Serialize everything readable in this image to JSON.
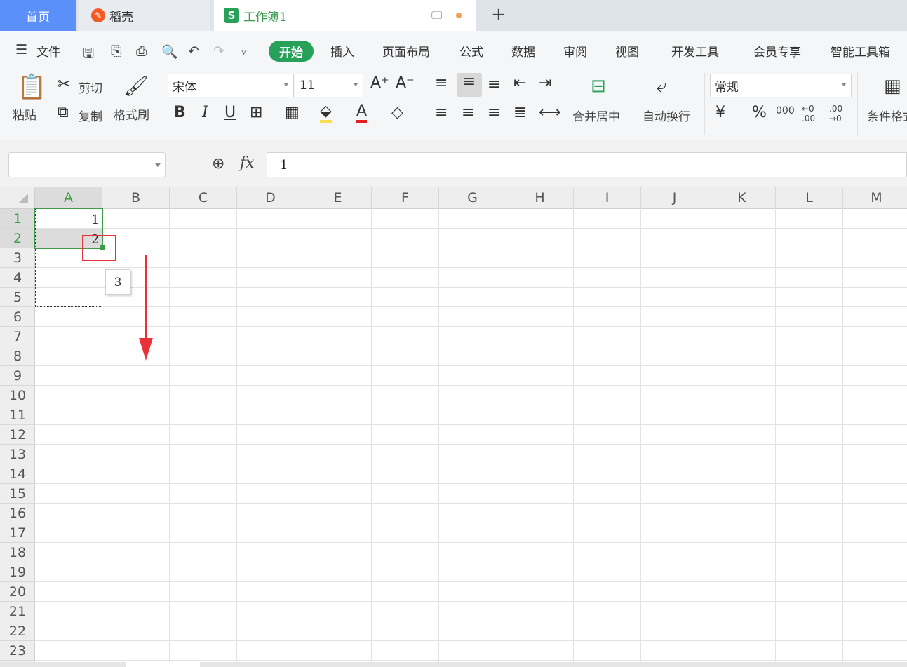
{
  "tabs": {
    "home": "首页",
    "daoke": "稻壳",
    "workbook": "工作簿1",
    "add": "+"
  },
  "menu": {
    "file": "文件",
    "items": [
      "开始",
      "插入",
      "页面布局",
      "公式",
      "数据",
      "审阅",
      "视图",
      "开发工具",
      "会员专享",
      "智能工具箱"
    ]
  },
  "ribbon": {
    "paste": "粘贴",
    "cut": "剪切",
    "copy": "复制",
    "format_painter": "格式刷",
    "font_name": "宋体",
    "font_size": "11",
    "merge_center": "合并居中",
    "wrap_text": "自动换行",
    "number_format": "常规",
    "conditional_format": "条件格式",
    "currency": "¥",
    "percent": "%",
    "thousands": "000",
    "inc_decimal": "←0 .00",
    "dec_decimal": ".00 →0"
  },
  "formula": {
    "fx": "fx",
    "value": "1"
  },
  "columns": [
    "A",
    "B",
    "C",
    "D",
    "E",
    "F",
    "G",
    "H",
    "I",
    "J",
    "K",
    "L",
    "M"
  ],
  "rows": [
    "1",
    "2",
    "3",
    "4",
    "5",
    "6",
    "7",
    "8",
    "9",
    "10",
    "11",
    "12",
    "13",
    "14",
    "15",
    "16",
    "17",
    "18",
    "19",
    "20",
    "21",
    "22",
    "23"
  ],
  "cells": {
    "A1": "1",
    "A2": "2"
  },
  "fill_tooltip": "3",
  "colors": {
    "accent": "#27a05a",
    "tab_active_bg": "#5b8ff9",
    "annotation_red": "#e8323b"
  }
}
